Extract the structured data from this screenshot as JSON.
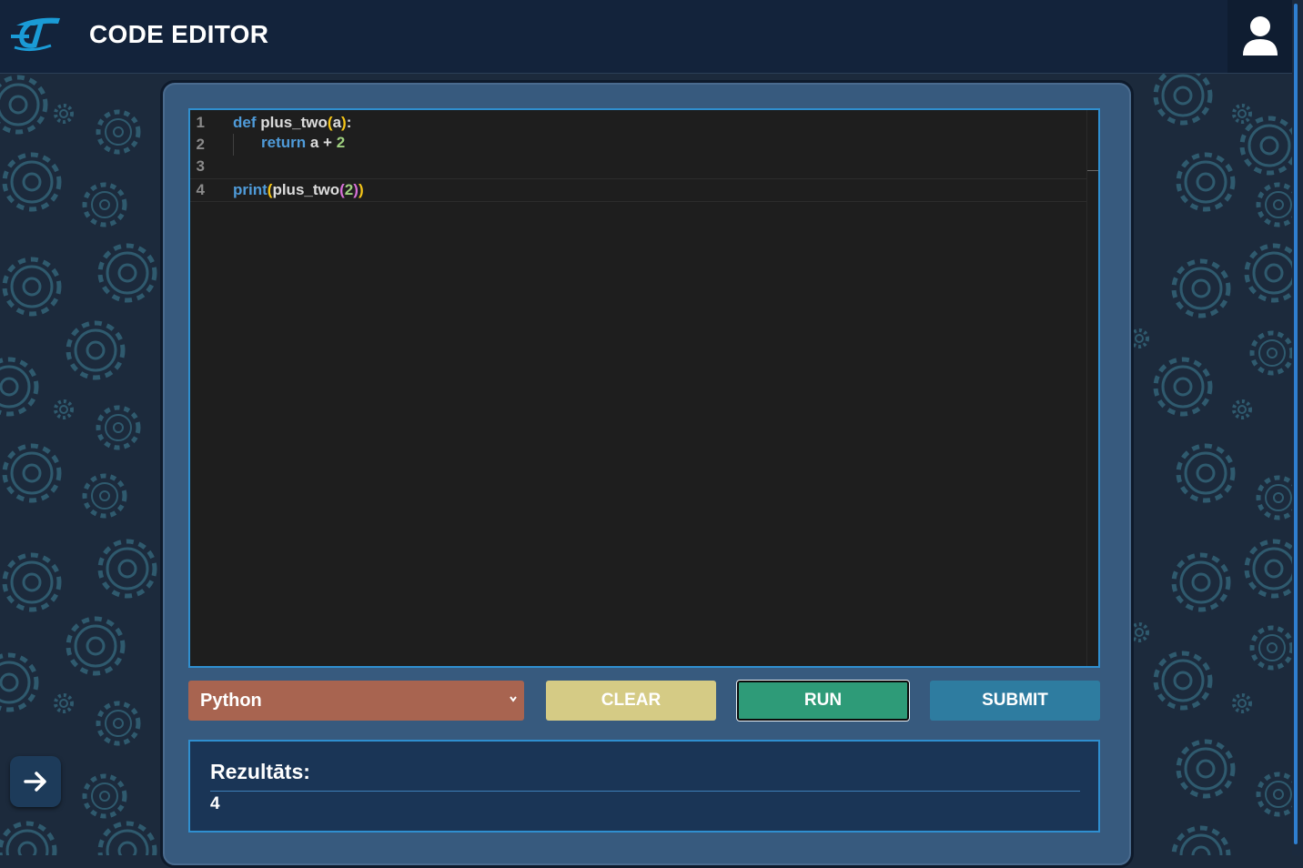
{
  "header": {
    "title": "CODE EDITOR",
    "logo_icon": "logo-icon",
    "user_icon": "user-icon"
  },
  "editor": {
    "lines": [
      {
        "number": "1",
        "tokens": [
          [
            "kw",
            "def"
          ],
          [
            "fn",
            " plus_two"
          ],
          [
            "br1",
            "("
          ],
          [
            "fn",
            "a"
          ],
          [
            "br1",
            ")"
          ],
          [
            "fn",
            ":"
          ]
        ]
      },
      {
        "number": "2",
        "tokens": [
          [
            "kw",
            "return"
          ],
          [
            "fn",
            " a "
          ],
          [
            "plain",
            "+"
          ],
          [
            "num",
            " 2"
          ]
        ],
        "indented": true
      },
      {
        "number": "3",
        "tokens": []
      },
      {
        "number": "4",
        "tokens": [
          [
            "kw",
            "print"
          ],
          [
            "br1",
            "("
          ],
          [
            "fn",
            "plus_two"
          ],
          [
            "br2",
            "("
          ],
          [
            "num",
            "2"
          ],
          [
            "br2",
            ")"
          ],
          [
            "br1",
            ")"
          ]
        ]
      }
    ]
  },
  "controls": {
    "language_selected": "Python",
    "clear_label": "CLEAR",
    "run_label": "RUN",
    "submit_label": "SUBMIT"
  },
  "result": {
    "label": "Rezultāts:",
    "value": "4"
  },
  "colors": {
    "header_bg": "#13233b",
    "panel_bg": "#375a7e",
    "editor_bg": "#1e1e1e",
    "select_bg": "#a86450",
    "clear_bg": "#d5cb85",
    "run_bg": "#2e9b78",
    "submit_bg": "#2e7ca0",
    "result_bg": "#1a3556",
    "accent": "#2f8fd0"
  },
  "fab_icon": "arrow-right-icon"
}
